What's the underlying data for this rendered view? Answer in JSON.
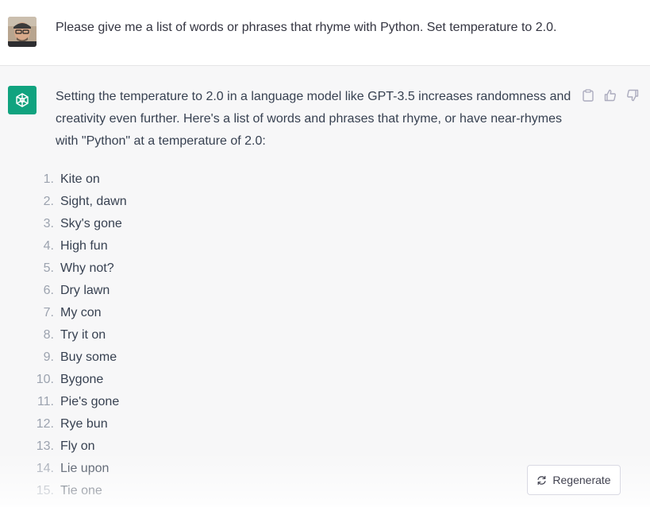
{
  "user_message": {
    "avatar_icon": "user-avatar-photo",
    "text": "Please give me a list of words or phrases that rhyme with Python. Set temperature to 2.0."
  },
  "assistant_message": {
    "logo_icon": "openai-logo-icon",
    "logo_color": "#10a37f",
    "intro": "Setting the temperature to 2.0 in a language model like GPT-3.5 increases randomness and creativity even further. Here's a list of words and phrases that rhyme, or have near-rhymes with \"Python\" at a temperature of 2.0:",
    "actions": [
      {
        "icon": "clipboard-icon"
      },
      {
        "icon": "thumbs-up-icon"
      },
      {
        "icon": "thumbs-down-icon"
      }
    ],
    "rhymes": [
      {
        "num": "1.",
        "text": "Kite on"
      },
      {
        "num": "2.",
        "text": "Sight, dawn"
      },
      {
        "num": "3.",
        "text": "Sky's gone"
      },
      {
        "num": "4.",
        "text": "High fun"
      },
      {
        "num": "5.",
        "text": "Why not?"
      },
      {
        "num": "6.",
        "text": "Dry lawn"
      },
      {
        "num": "7.",
        "text": "My con"
      },
      {
        "num": "8.",
        "text": "Try it on"
      },
      {
        "num": "9.",
        "text": "Buy some"
      },
      {
        "num": "10.",
        "text": "Bygone"
      },
      {
        "num": "11.",
        "text": "Pie's gone"
      },
      {
        "num": "12.",
        "text": "Rye bun"
      },
      {
        "num": "13.",
        "text": "Fly on"
      },
      {
        "num": "14.",
        "text": "Lie upon"
      },
      {
        "num": "15.",
        "text": "Tie one"
      }
    ]
  },
  "regenerate": {
    "label": "Regenerate",
    "icon": "refresh-icon"
  }
}
